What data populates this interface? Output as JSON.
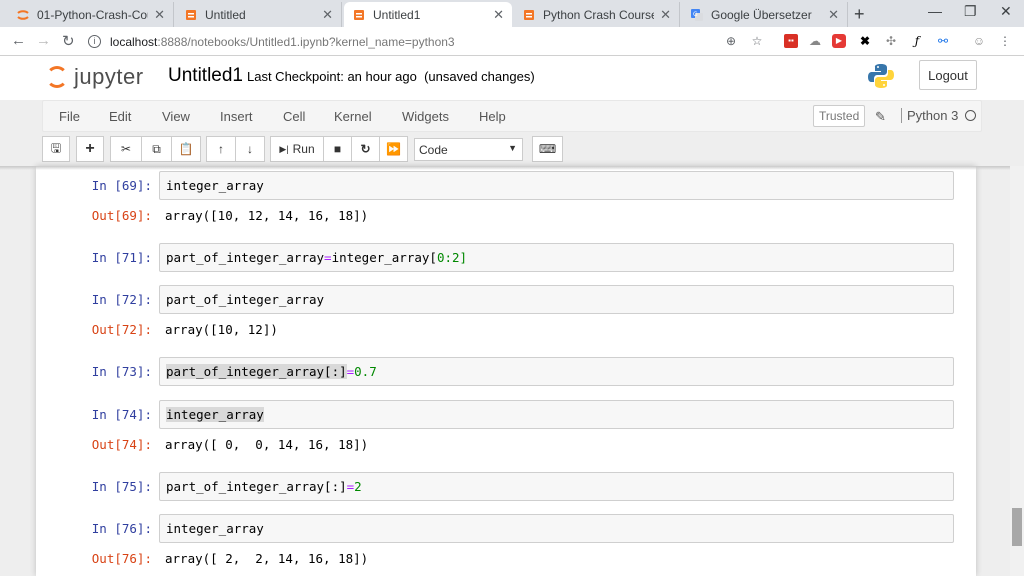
{
  "browser": {
    "tabs": [
      {
        "title": "01-Python-Crash-Course/",
        "icon": "jupyter-tab-icon"
      },
      {
        "title": "Untitled",
        "icon": "notebook-tab-icon"
      },
      {
        "title": "Untitled1",
        "icon": "notebook-tab-icon"
      },
      {
        "title": "Python Crash Course Exerci",
        "icon": "notebook-tab-icon"
      },
      {
        "title": "Google Übersetzer",
        "icon": "translate-tab-icon"
      }
    ],
    "address_host": "localhost",
    "address_path": ":8888/notebooks/Untitled1.ipynb?kernel_name=python3"
  },
  "header": {
    "logo_text": "jupyter",
    "notebook_name": "Untitled1",
    "checkpoint": "Last Checkpoint: an hour ago",
    "autosave_status": "(unsaved changes)",
    "logout_label": "Logout"
  },
  "menubar": {
    "items": [
      "File",
      "Edit",
      "View",
      "Insert",
      "Cell",
      "Kernel",
      "Widgets",
      "Help"
    ],
    "trusted": "Trusted",
    "kernel": "Python 3"
  },
  "toolbar": {
    "run_label": "Run",
    "cell_type": "Code"
  },
  "cells": [
    {
      "in": "In [69]:",
      "code": "integer_array",
      "out": "Out[69]:",
      "result": "array([10, 12, 14, 16, 18])"
    },
    {
      "in": "In [71]:",
      "code_parts": [
        "part_of_integer_array",
        "=",
        "integer_array[",
        "0",
        ":",
        "2",
        "]"
      ]
    },
    {
      "in": "In [72]:",
      "code": "part_of_integer_array",
      "out": "Out[72]:",
      "result": "array([10, 12])"
    },
    {
      "in": "In [73]:",
      "code_parts": [
        "part_of_integer_array[:]",
        "=",
        "0.7"
      ]
    },
    {
      "in": "In [74]:",
      "code": "integer_array",
      "out": "Out[74]:",
      "result": "array([ 0,  0, 14, 16, 18])"
    },
    {
      "in": "In [75]:",
      "code_parts": [
        "part_of_integer_array[:]",
        "=",
        "2"
      ]
    },
    {
      "in": "In [76]:",
      "code": "integer_array",
      "out": "Out[76]:",
      "result": "array([ 2,  2, 14, 16, 18])"
    }
  ]
}
